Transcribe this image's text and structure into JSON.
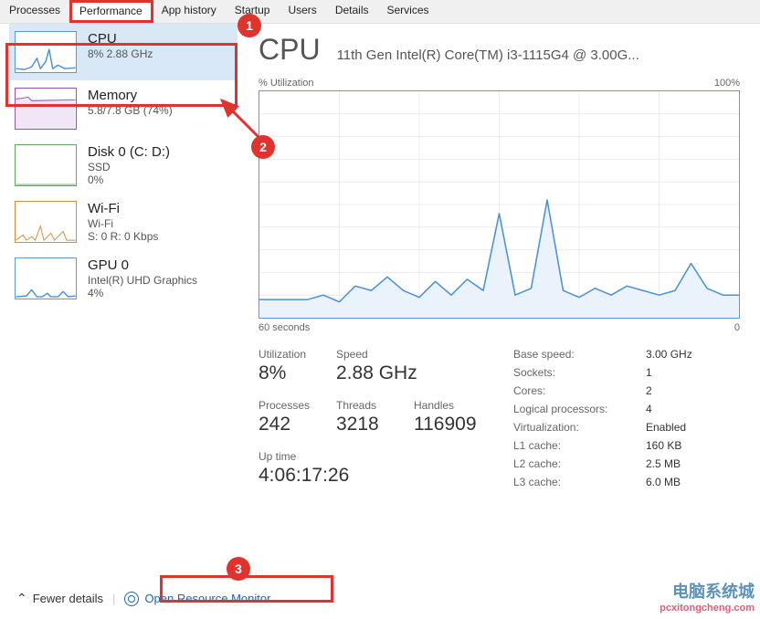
{
  "tabs": [
    "Processes",
    "Performance",
    "App history",
    "Startup",
    "Users",
    "Details",
    "Services"
  ],
  "active_tab_index": 1,
  "sidebar": [
    {
      "title": "CPU",
      "sub1": "8%  2.88 GHz",
      "sub2": ""
    },
    {
      "title": "Memory",
      "sub1": "5.8/7.8 GB (74%)",
      "sub2": ""
    },
    {
      "title": "Disk 0 (C: D:)",
      "sub1": "SSD",
      "sub2": "0%"
    },
    {
      "title": "Wi-Fi",
      "sub1": "Wi-Fi",
      "sub2": "S: 0 R: 0 Kbps"
    },
    {
      "title": "GPU 0",
      "sub1": "Intel(R) UHD Graphics",
      "sub2": "4%"
    }
  ],
  "selected_sidebar_index": 0,
  "header": {
    "main": "CPU",
    "sub": "11th Gen Intel(R) Core(TM) i3-1115G4 @ 3.00G..."
  },
  "chart": {
    "label_tl": "% Utilization",
    "label_tr": "100%",
    "label_bl": "60 seconds",
    "label_br": "0"
  },
  "chart_data": {
    "type": "line",
    "title": "% Utilization",
    "xlabel": "seconds",
    "ylabel": "%",
    "ylim": [
      0,
      100
    ],
    "xlim": [
      60,
      0
    ],
    "x": [
      60,
      58,
      56,
      54,
      52,
      50,
      48,
      46,
      44,
      42,
      40,
      38,
      36,
      34,
      32,
      30,
      28,
      26,
      24,
      22,
      20,
      18,
      16,
      14,
      12,
      10,
      8,
      6,
      4,
      2,
      0
    ],
    "values": [
      8,
      8,
      8,
      8,
      10,
      7,
      14,
      12,
      18,
      12,
      9,
      16,
      10,
      17,
      12,
      46,
      10,
      13,
      52,
      12,
      9,
      13,
      10,
      14,
      12,
      10,
      12,
      24,
      13,
      10,
      10
    ]
  },
  "stats": {
    "utilization_lbl": "Utilization",
    "utilization": "8%",
    "speed_lbl": "Speed",
    "speed": "2.88 GHz",
    "processes_lbl": "Processes",
    "processes": "242",
    "threads_lbl": "Threads",
    "threads": "3218",
    "handles_lbl": "Handles",
    "handles": "116909",
    "uptime_lbl": "Up time",
    "uptime": "4:06:17:26"
  },
  "info": [
    {
      "k": "Base speed:",
      "v": "3.00 GHz"
    },
    {
      "k": "Sockets:",
      "v": "1"
    },
    {
      "k": "Cores:",
      "v": "2"
    },
    {
      "k": "Logical processors:",
      "v": "4"
    },
    {
      "k": "Virtualization:",
      "v": "Enabled"
    },
    {
      "k": "L1 cache:",
      "v": "160 KB"
    },
    {
      "k": "L2 cache:",
      "v": "2.5 MB"
    },
    {
      "k": "L3 cache:",
      "v": "6.0 MB"
    }
  ],
  "footer": {
    "fewer": "Fewer details",
    "resmon": "Open Resource Monitor"
  },
  "watermark": {
    "line1": "电脑系统城",
    "line2": "pcxitongcheng.com"
  },
  "annotations": {
    "dot1": "1",
    "dot2": "2",
    "dot3": "3"
  },
  "colors": {
    "red": "#e1322d",
    "blue": "#4a90d9",
    "sel": "#d9e8f7",
    "link": "#1567c7",
    "orange": "#d98a3a",
    "green": "#5aab5a"
  }
}
